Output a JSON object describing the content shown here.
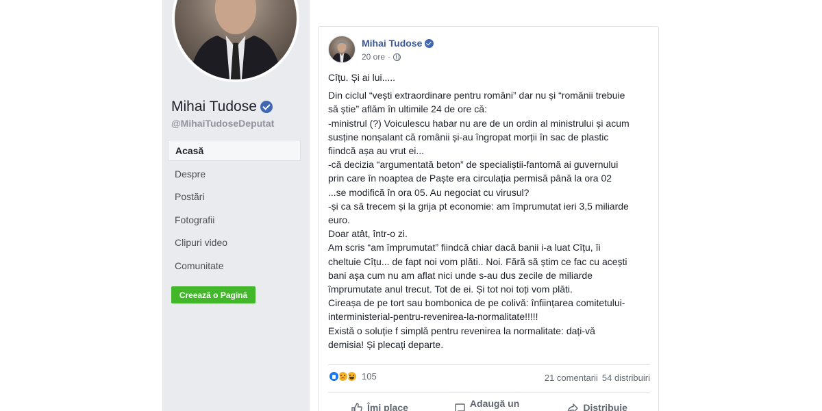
{
  "sidebar": {
    "page_name": "Mihai Tudose",
    "handle": "@MihaiTudoseDeputat",
    "nav": [
      {
        "label": "Acasă",
        "active": true
      },
      {
        "label": "Despre",
        "active": false
      },
      {
        "label": "Postări",
        "active": false
      },
      {
        "label": "Fotografii",
        "active": false
      },
      {
        "label": "Clipuri video",
        "active": false
      },
      {
        "label": "Comunitate",
        "active": false
      }
    ],
    "create_page_label": "Creează o Pagină"
  },
  "post": {
    "author": "Mihai Tudose",
    "time": "20 ore",
    "separator": "·",
    "privacy_icon": "globe-icon",
    "lead": "Cîțu. Și ai lui.....",
    "lines": [
      "Din ciclul “vești extraordinare pentru români” dar nu și “românii trebuie",
      "să știe” aflăm în ultimile 24 de ore că:",
      "-ministrul (?) Voiculescu habar nu are de un ordin al ministrului și acum",
      "susține nonșalant că românii și-au îngropat morții în sac de plastic",
      "fiindcă așa au vrut ei...",
      "-că decizia “argumentată beton” de specialiștii-fantomă ai guvernului",
      "prin care în noaptea de Paște era circulația permisă până la ora 02",
      "...se modifică în ora 05. Au negociat cu virusul?",
      "-și ca să trecem și la grija pt economie: am împrumutat ieri 3,5 miliarde",
      "euro.",
      "Doar atât, într-o zi.",
      "Am scris “am împrumutat” fiindcă chiar dacă banii i-a luat Cîțu, îi",
      "cheltuie Cîțu... de fapt noi vom plăti.. Noi. Fără să știm ce fac cu acești",
      "bani așa cum nu am aflat nici unde s-au dus zecile de miliarde",
      "împrumutate anul trecut. Tot de ei. Și tot noi toți vom plăti.",
      "Cireașa de pe tort sau bombonica de pe colivă: înființarea comitetului-",
      "interministerial-pentru-revenirea-la-normalitate!!!!!",
      "Există o soluție f simplă pentru revenirea la normalitate: dați-vă",
      "demisia! Și plecați departe."
    ],
    "reaction_count": "105",
    "reaction_types": [
      "like",
      "sad",
      "haha"
    ],
    "comments": "21 comentarii",
    "shares": "54 distribuiri",
    "actions": {
      "like": "Îmi place",
      "comment_line1": "Adaugă un",
      "comment_line2": "comentariu",
      "share": "Distribuie"
    }
  },
  "colors": {
    "sidebar_bg": "#e9ebee",
    "link_blue": "#385898",
    "verified_blue": "#4267b2",
    "create_button_green": "#42b72a",
    "text_primary": "#1d2129",
    "text_secondary": "#616770"
  }
}
